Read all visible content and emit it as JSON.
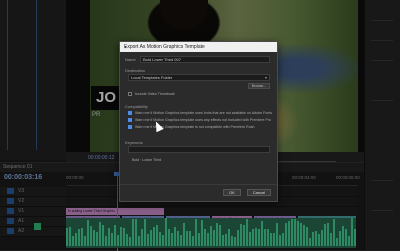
{
  "left_panel": {},
  "program_monitor": {
    "logo_text": "JO",
    "logo_sub": "PR",
    "timecode": "00:00:00:12"
  },
  "timeline": {
    "title": "Sequence 01",
    "timecode": "00:00:03:16",
    "ruler": [
      "00:00:00",
      "00:00:01:00",
      "00:00:02:00",
      "00:00:03:00",
      "00:00:04:00",
      "00:00:05:00"
    ],
    "tracks": [
      "V3",
      "V2",
      "V1",
      "A1",
      "A2"
    ],
    "clips": [
      {
        "label": "fx  adding Lower Third Graphic",
        "color": "pink"
      },
      {
        "label": "fx  Adobe Stock",
        "color": "violet"
      },
      {
        "label": "fx  adobe-stock-clip-audio",
        "color": "blue"
      },
      {
        "label": "fx  adobe-stock-speaking.mp4",
        "color": "blue"
      },
      {
        "label": "fx  Adobe Stock",
        "color": "pink"
      },
      {
        "label": "fx  adobe-stock-clip",
        "color": "violet"
      },
      {
        "label": "fx  adobe-stock-interview",
        "color": "teal"
      }
    ]
  },
  "dialog": {
    "title": "Export As Motion Graphics Template",
    "close_icon": "×",
    "name_label": "Name",
    "name_value": "Bold Lower Third 007",
    "destination_label": "Destination",
    "destination_value": "Local Templates Folder",
    "browse_label": "Browse...",
    "include_video_label": "Include Video Thumbnail",
    "compatibility_label": "Compatibility",
    "compat_items": [
      "Warn me if Motion Graphics template uses fonts that are not available on Adobe Fonts",
      "Warn me if Motion Graphics template uses any effects not included with Premiere Pro",
      "Warn me if Motion Graphics template is not compatible with Premiere Rush"
    ],
    "keywords_label": "Keywords",
    "keyword_value": "Bold · Lower Third",
    "ok_label": "OK",
    "cancel_label": "Cancel"
  },
  "colors": {
    "accent": "#4a8de8",
    "audio": "#45d498",
    "clip_pink": "#d593d3",
    "clip_violet": "#a98bd9"
  }
}
